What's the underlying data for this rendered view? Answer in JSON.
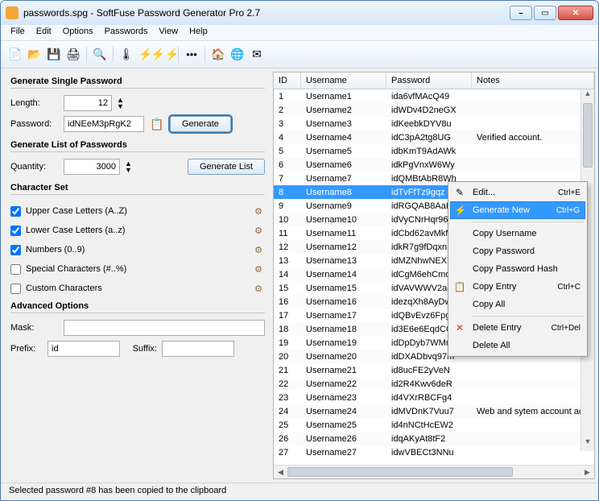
{
  "title": "passwords.spg - SoftFuse Password Generator Pro 2.7",
  "menu": {
    "file": "File",
    "edit": "Edit",
    "options": "Options",
    "passwords": "Passwords",
    "view": "View",
    "help": "Help"
  },
  "left": {
    "single_title": "Generate Single Password",
    "length_label": "Length:",
    "length_value": "12",
    "password_label": "Password:",
    "password_value": "idNEeM3pRgK2",
    "generate_btn": "Generate",
    "list_title": "Generate List of Passwords",
    "quantity_label": "Quantity:",
    "quantity_value": "3000",
    "genlist_btn": "Generate List",
    "charset_title": "Character Set",
    "upper": "Upper Case Letters (A..Z)",
    "lower": "Lower Case Letters (a..z)",
    "numbers": "Numbers (0..9)",
    "special": "Special Characters (#..%)",
    "custom": "Custom Characters",
    "advanced_title": "Advanced Options",
    "mask_label": "Mask:",
    "mask_value": "",
    "prefix_label": "Prefix:",
    "prefix_value": "id",
    "suffix_label": "Suffix:",
    "suffix_value": ""
  },
  "table": {
    "headers": {
      "id": "ID",
      "user": "Username",
      "pass": "Password",
      "notes": "Notes"
    },
    "rows": [
      {
        "id": "1",
        "user": "Username1",
        "pass": "ida6vfMAcQ49",
        "notes": ""
      },
      {
        "id": "2",
        "user": "Username2",
        "pass": "idWDv4D2neGX",
        "notes": ""
      },
      {
        "id": "3",
        "user": "Username3",
        "pass": "idKeebkDYV8u",
        "notes": ""
      },
      {
        "id": "4",
        "user": "Username4",
        "pass": "idC3pA2tg8UG",
        "notes": "Verified account."
      },
      {
        "id": "5",
        "user": "Username5",
        "pass": "idbKmT9AdAWk",
        "notes": ""
      },
      {
        "id": "6",
        "user": "Username6",
        "pass": "idkPgVnxW6Wy",
        "notes": ""
      },
      {
        "id": "7",
        "user": "Username7",
        "pass": "idQMBtAbR8Wh",
        "notes": ""
      },
      {
        "id": "8",
        "user": "Username8",
        "pass": "idTvFfTz9gqz",
        "notes": ""
      },
      {
        "id": "9",
        "user": "Username9",
        "pass": "idRGQAB8AaKB",
        "notes": ""
      },
      {
        "id": "10",
        "user": "Username10",
        "pass": "idVyCNrHqr96",
        "notes": ""
      },
      {
        "id": "11",
        "user": "Username11",
        "pass": "idCbd62avMkM",
        "notes": ""
      },
      {
        "id": "12",
        "user": "Username12",
        "pass": "idkR7g9fDqxn",
        "notes": ""
      },
      {
        "id": "13",
        "user": "Username13",
        "pass": "idMZNhwNEX7m",
        "notes": ""
      },
      {
        "id": "14",
        "user": "Username14",
        "pass": "idCgM6ehCmdY",
        "notes": ""
      },
      {
        "id": "15",
        "user": "Username15",
        "pass": "idVAVWWV2ac2",
        "notes": ""
      },
      {
        "id": "16",
        "user": "Username16",
        "pass": "idezqXh8AyDw",
        "notes": ""
      },
      {
        "id": "17",
        "user": "Username17",
        "pass": "idQBvEvz6Fpg",
        "notes": ""
      },
      {
        "id": "18",
        "user": "Username18",
        "pass": "id3E6e6EqdCC",
        "notes": ""
      },
      {
        "id": "19",
        "user": "Username19",
        "pass": "idDpDyb7WMr8",
        "notes": ""
      },
      {
        "id": "20",
        "user": "Username20",
        "pass": "idDXADbvq97m",
        "notes": ""
      },
      {
        "id": "21",
        "user": "Username21",
        "pass": "id8ucFE2yVeN",
        "notes": ""
      },
      {
        "id": "22",
        "user": "Username22",
        "pass": "id2R4Kwv6deR",
        "notes": ""
      },
      {
        "id": "23",
        "user": "Username23",
        "pass": "id4VXrRBCFg4",
        "notes": ""
      },
      {
        "id": "24",
        "user": "Username24",
        "pass": "idMVDnK7Vuu7",
        "notes": "Web and sytem account ac"
      },
      {
        "id": "25",
        "user": "Username25",
        "pass": "id4nNCtHcEW2",
        "notes": ""
      },
      {
        "id": "26",
        "user": "Username26",
        "pass": "idqAKyAt8tF2",
        "notes": ""
      },
      {
        "id": "27",
        "user": "Username27",
        "pass": "idwVBECt3NNu",
        "notes": ""
      }
    ],
    "selected_index": 7
  },
  "context": {
    "edit": "Edit...",
    "edit_sc": "Ctrl+E",
    "gen": "Generate New",
    "gen_sc": "Ctrl+G",
    "copy_user": "Copy Username",
    "copy_pass": "Copy Password",
    "copy_hash": "Copy Password Hash",
    "copy_entry": "Copy Entry",
    "copy_entry_sc": "Ctrl+C",
    "copy_all": "Copy All",
    "del_entry": "Delete Entry",
    "del_sc": "Ctrl+Del",
    "del_all": "Delete All"
  },
  "status": "Selected password #8 has been copied to the clipboard"
}
